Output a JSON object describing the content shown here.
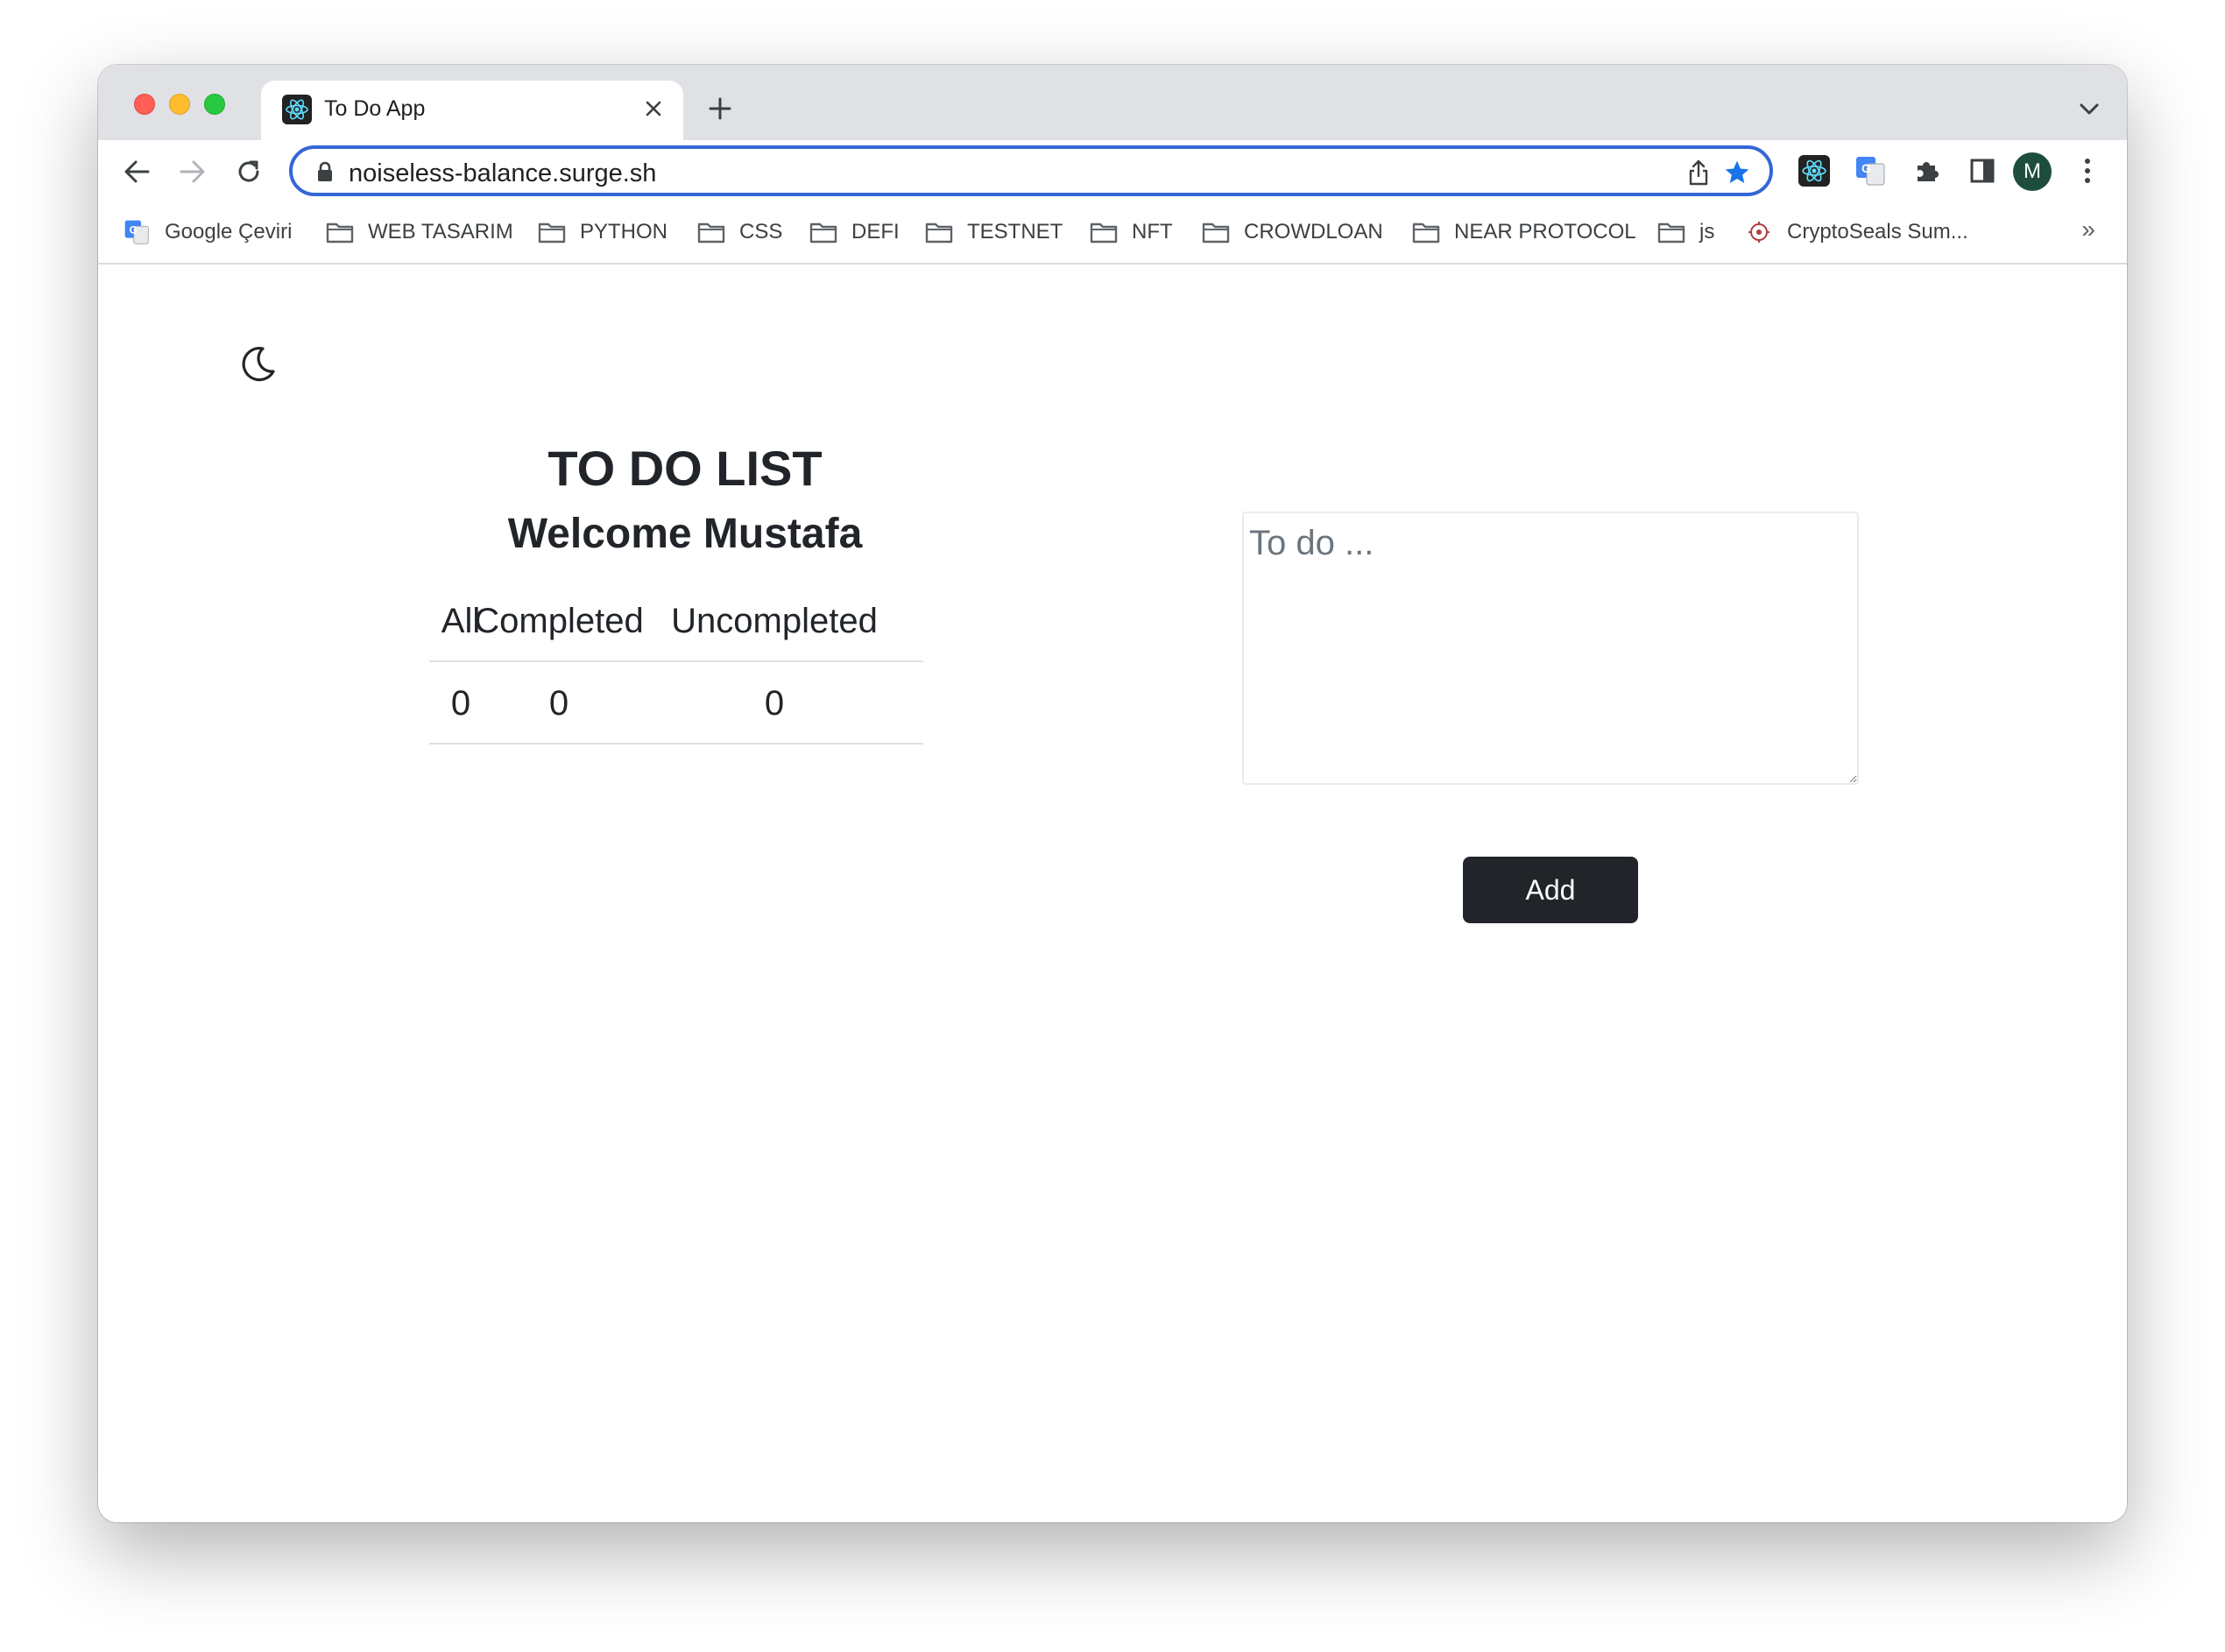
{
  "browser": {
    "tab_title": "To Do App",
    "url": "noiseless-balance.surge.sh",
    "profile_initial": "M",
    "bookmarks": [
      {
        "label": "Google Çeviri",
        "icon": "google-translate-icon"
      },
      {
        "label": "WEB TASARIM",
        "icon": "folder-icon"
      },
      {
        "label": "PYTHON",
        "icon": "folder-icon"
      },
      {
        "label": "CSS",
        "icon": "folder-icon"
      },
      {
        "label": "DEFI",
        "icon": "folder-icon"
      },
      {
        "label": "TESTNET",
        "icon": "folder-icon"
      },
      {
        "label": "NFT",
        "icon": "folder-icon"
      },
      {
        "label": "CROWDLOAN",
        "icon": "folder-icon"
      },
      {
        "label": "NEAR PROTOCOL",
        "icon": "folder-icon"
      },
      {
        "label": "js",
        "icon": "folder-icon"
      },
      {
        "label": "CryptoSeals Sum...",
        "icon": "cryptoseals-icon"
      }
    ],
    "bookmarks_more": "»",
    "accent_color": "#3367d6"
  },
  "page": {
    "theme_toggle_icon": "moon-icon",
    "title": "TO DO LIST",
    "welcome": "Welcome Mustafa",
    "stats": {
      "headers": [
        "All",
        "Completed",
        "Uncompleted"
      ],
      "values": [
        "0",
        "0",
        "0"
      ]
    },
    "todo_placeholder": "To do ...",
    "todo_value": "",
    "add_label": "Add",
    "button_color": "#212529"
  }
}
